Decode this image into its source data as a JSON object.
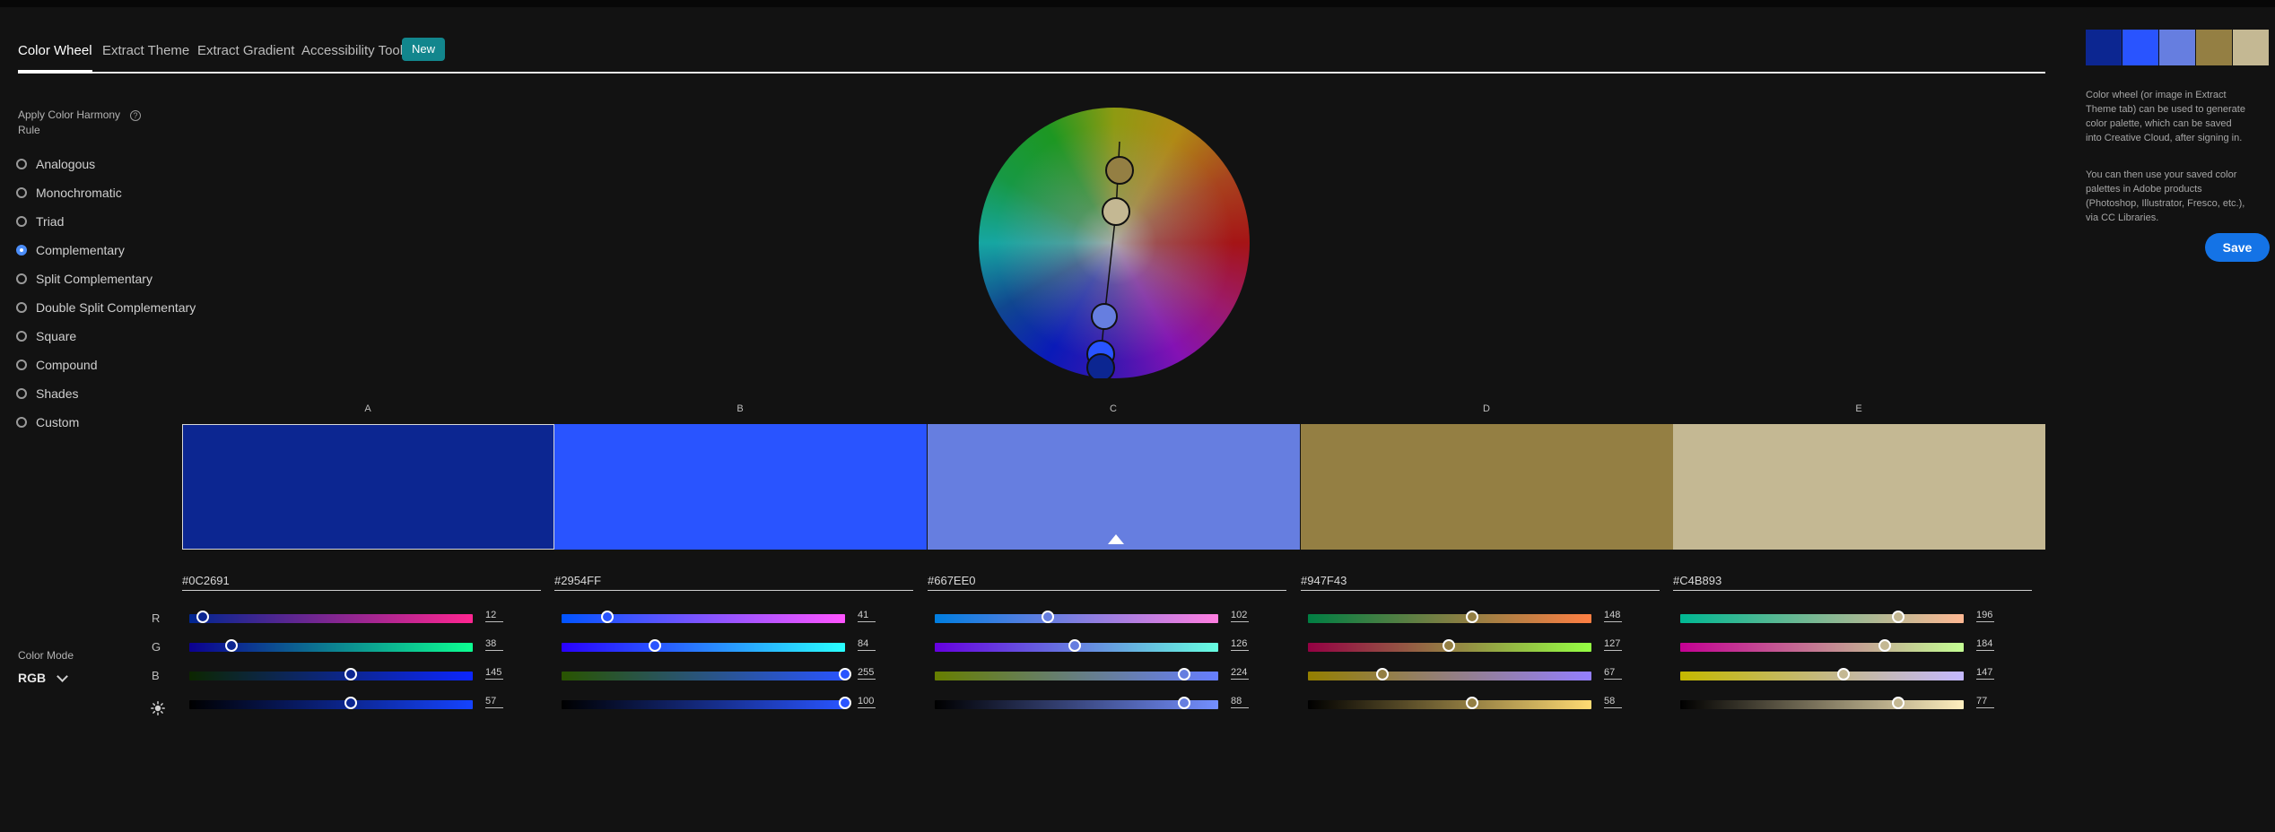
{
  "tabs": [
    {
      "label": "Color Wheel",
      "active": true
    },
    {
      "label": "Extract Theme",
      "active": false
    },
    {
      "label": "Extract Gradient",
      "active": false
    },
    {
      "label": "Accessibility Tools",
      "active": false
    }
  ],
  "new_badge": "New",
  "harmony": {
    "title": "Apply Color Harmony Rule",
    "info_icon": "info-icon",
    "selected": "Complementary",
    "rules": [
      "Analogous",
      "Monochromatic",
      "Triad",
      "Complementary",
      "Split Complementary",
      "Double Split Complementary",
      "Square",
      "Compound",
      "Shades",
      "Custom"
    ]
  },
  "color_mode": {
    "label": "Color Mode",
    "value": "RGB"
  },
  "swatches": [
    {
      "letter": "A",
      "hex": "#0C2691",
      "r": 12,
      "g": 38,
      "b": 145,
      "brightness": 57,
      "selected": true
    },
    {
      "letter": "B",
      "hex": "#2954FF",
      "r": 41,
      "g": 84,
      "b": 255,
      "brightness": 100,
      "selected": false
    },
    {
      "letter": "C",
      "hex": "#667EE0",
      "r": 102,
      "g": 126,
      "b": 224,
      "brightness": 88,
      "selected": false
    },
    {
      "letter": "D",
      "hex": "#947F43",
      "r": 148,
      "g": 127,
      "b": 67,
      "brightness": 58,
      "selected": false
    },
    {
      "letter": "E",
      "hex": "#C4B893",
      "r": 196,
      "g": 184,
      "b": 147,
      "brightness": 77,
      "selected": false
    }
  ],
  "channels": {
    "r": "R",
    "g": "G",
    "b": "B",
    "brightness_icon": "brightness-icon"
  },
  "side_panel": {
    "description_1": "Color wheel (or image in Extract Theme tab) can be used to generate color palette, which can be saved into Creative Cloud, after signing in.",
    "description_2": "You can then use your saved color palettes in Adobe products (Photoshop, Illustrator, Fresco, etc.), via CC Libraries.",
    "save_label": "Save"
  },
  "colors": {
    "accent": "#1473e6",
    "badge": "#12868d",
    "background": "#121212"
  }
}
